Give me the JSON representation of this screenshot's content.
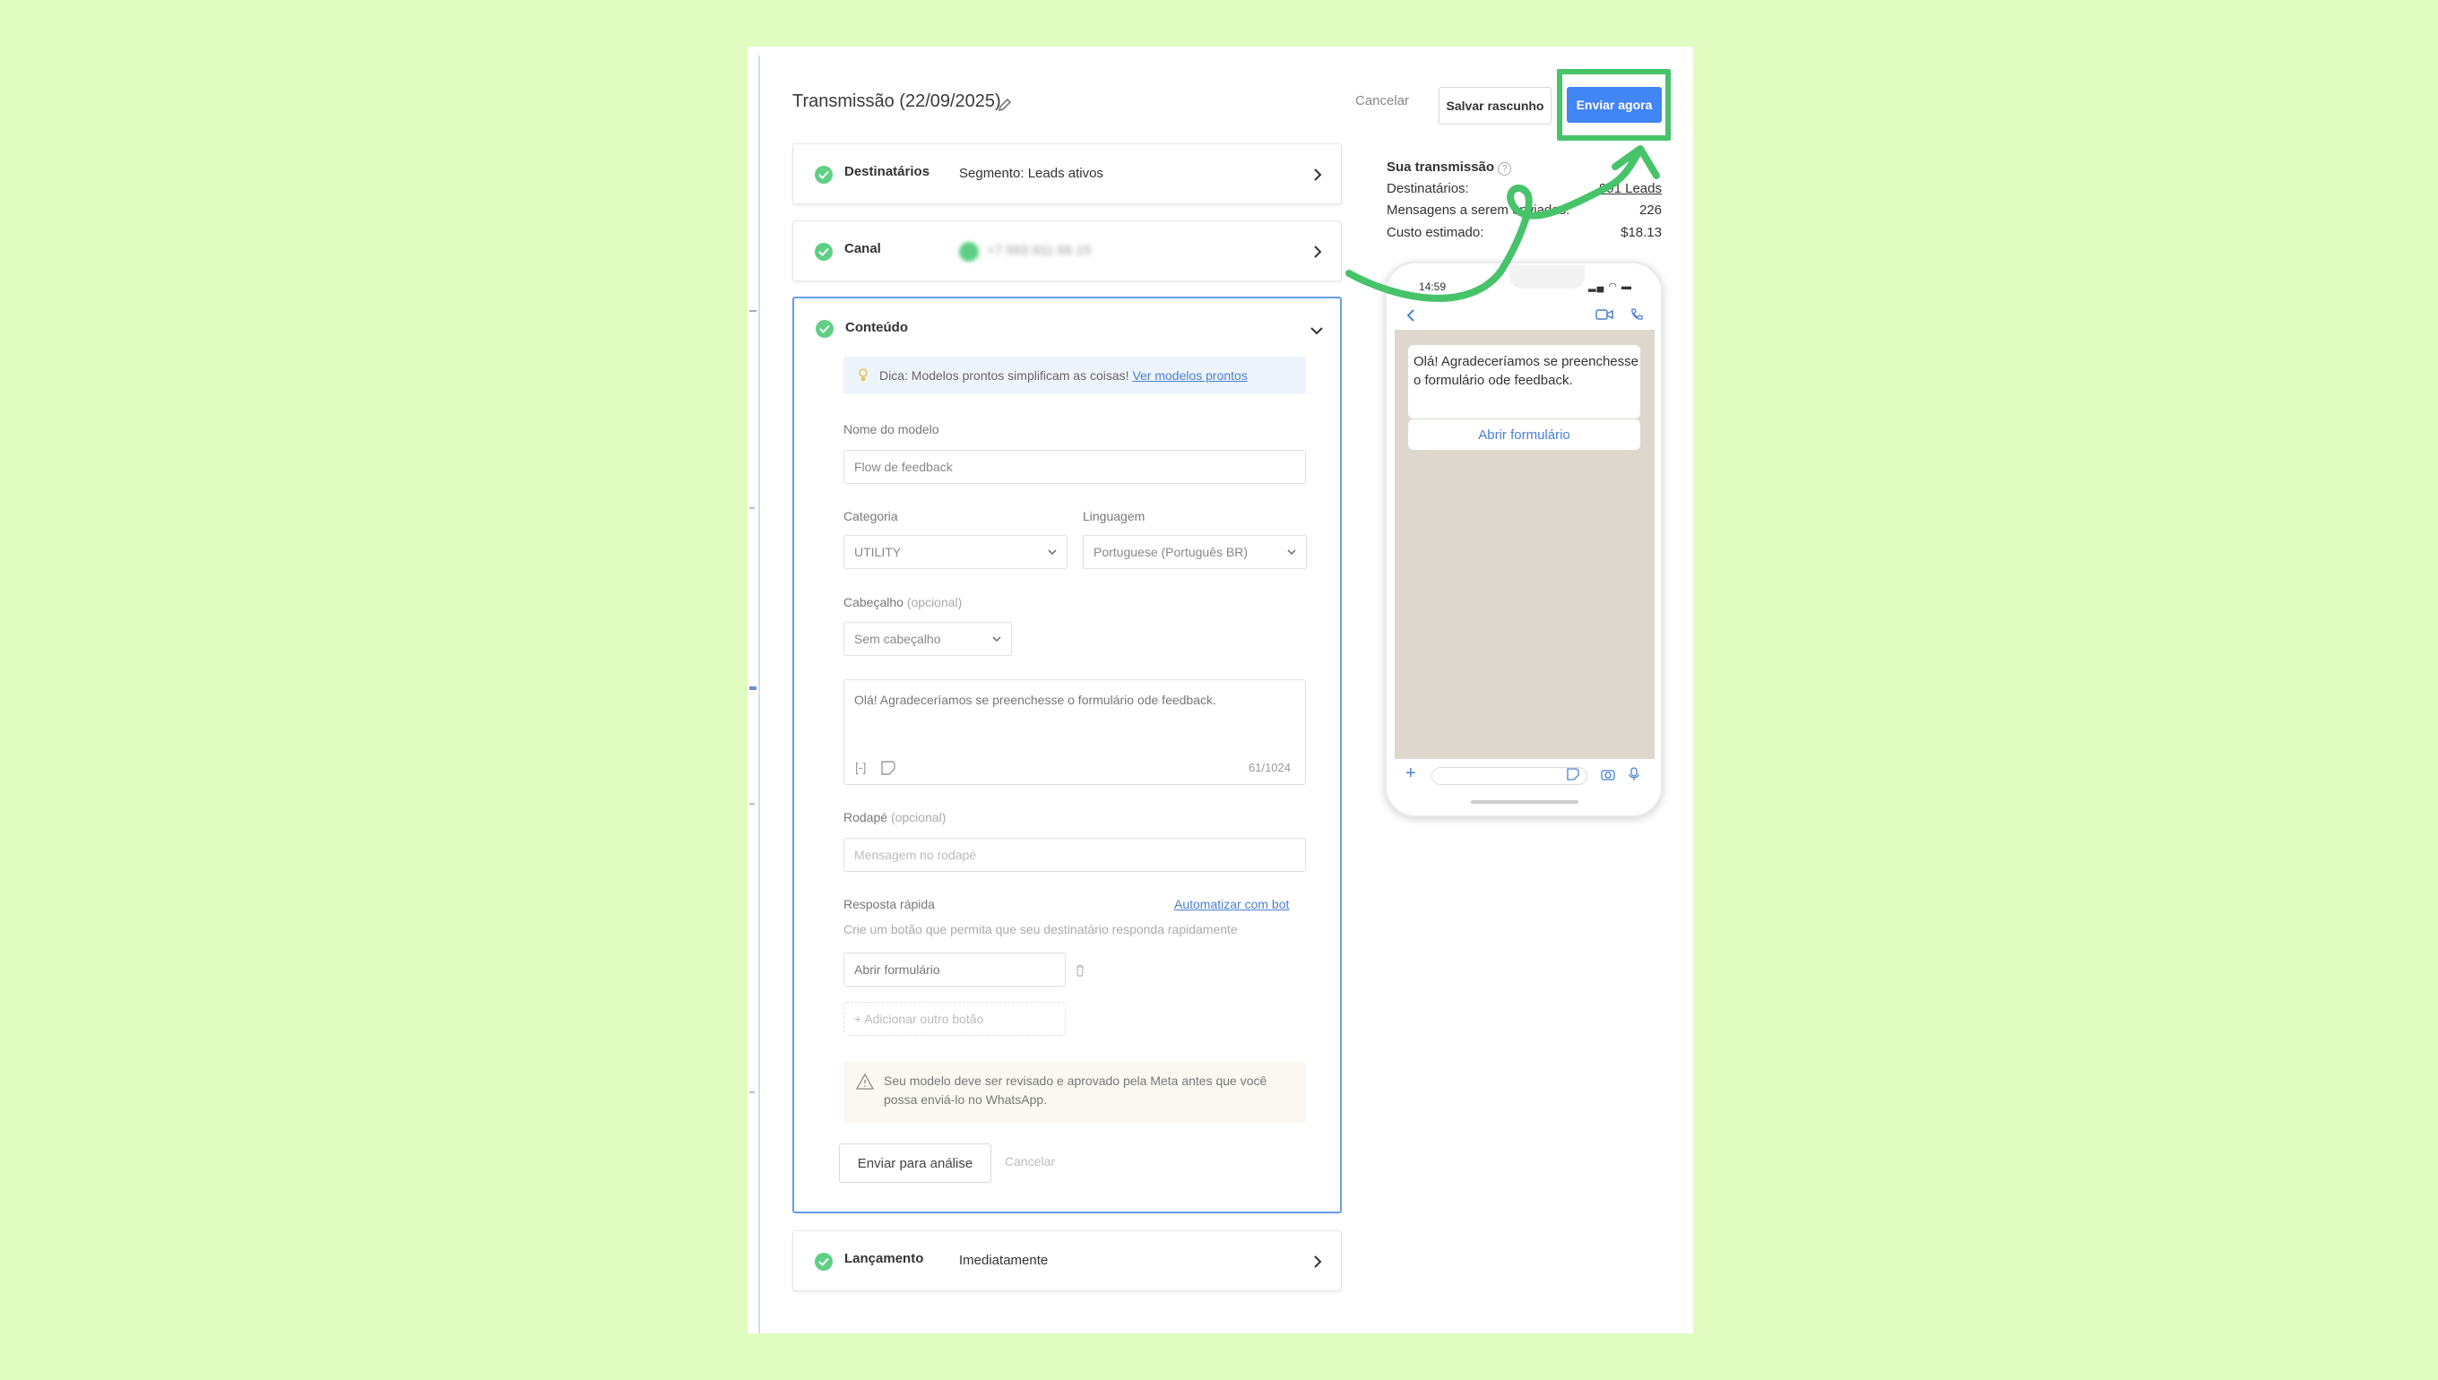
{
  "header": {
    "title": "Transmissão (22/09/2025)",
    "cancel_label": "Cancelar",
    "save_draft_label": "Salvar rascunho",
    "send_now_label": "Enviar agora"
  },
  "steps": {
    "recipients": {
      "label": "Destinatários",
      "value": "Segmento: Leads ativos"
    },
    "channel": {
      "label": "Canal",
      "value": "+7 993 911 66 15"
    },
    "content": {
      "label": "Conteúdo"
    },
    "launch": {
      "label": "Lançamento",
      "value": "Imediatamente"
    }
  },
  "content_form": {
    "tip_text": "Dica: Modelos prontos simplificam as coisas!",
    "tip_link": "Ver modelos prontos",
    "template_name_label": "Nome do modelo",
    "template_name_value": "Flow de feedback",
    "category_label": "Categoria",
    "category_value": "UTILITY",
    "language_label": "Linguagem",
    "language_value": "Portuguese (Português BR)",
    "header_label": "Cabeçalho",
    "optional_text": "(opcional)",
    "header_value": "Sem cabeçalho",
    "message_text": "Olá! Agradeceríamos se preenchesse o formulário ode feedback.",
    "char_count": "61/1024",
    "footer_label": "Rodapé",
    "footer_placeholder": "Mensagem no rodapé",
    "quick_reply_label": "Resposta rápida",
    "automate_link": "Automatizar com bot",
    "quick_reply_hint": "Crie um botão que permita que seu destinatário responda rapidamente",
    "button_value": "Abrir formulário",
    "add_button_label": "+ Adicionar outro botão",
    "warning_text": "Seu modelo deve ser revisado e aprovado pela Meta antes que você possa enviá-lo no WhatsApp.",
    "submit_label": "Enviar para análise",
    "cancel_label": "Cancelar"
  },
  "summary": {
    "title": "Sua transmissão",
    "recipients_label": "Destinatários:",
    "recipients_value": "891 Leads",
    "messages_label": "Mensagens a serem enviadas:",
    "messages_value": "226",
    "cost_label": "Custo estimado:",
    "cost_value": "$18.13"
  },
  "preview": {
    "time": "14:59",
    "message": "Olá! Agradeceríamos se preenchesse o formulário ode feedback.",
    "button": "Abrir formulário"
  },
  "colors": {
    "page_background": "#e0fcc0",
    "primary_button": "#4285f4",
    "highlight_green": "#47c36a",
    "check_green": "#5fcf85",
    "link_blue": "#4a7fd4"
  }
}
